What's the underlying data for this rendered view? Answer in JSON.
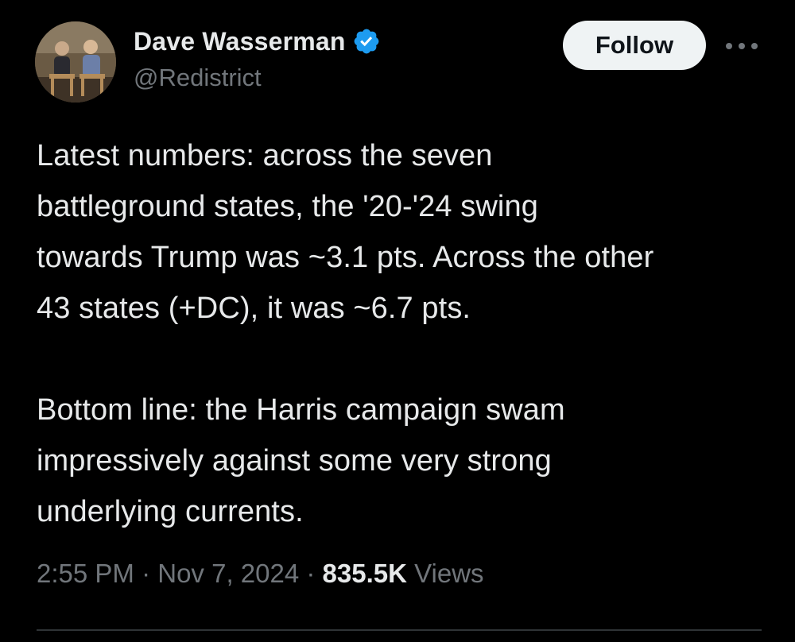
{
  "author": {
    "display_name": "Dave Wasserman",
    "handle": "@Redistrict",
    "verified": true,
    "avatar_icon": "avatar-photo-icon",
    "badge_icon": "verified-badge-icon"
  },
  "actions": {
    "follow_label": "Follow",
    "more_icon": "more-options-icon"
  },
  "tweet": {
    "text": "Latest numbers: across the seven\nbattleground states, the '20-'24 swing\ntowards Trump was ~3.1 pts. Across the other\n43 states (+DC), it was ~6.7 pts.\n\nBottom line: the Harris campaign swam\nimpressively against some very strong\nunderlying currents.",
    "time": "2:55 PM",
    "separator": " · ",
    "date": "Nov 7, 2024",
    "views_count": "835.5K",
    "views_label": "Views"
  },
  "colors": {
    "background": "#000000",
    "text_primary": "#e7e9ea",
    "text_secondary": "#71767b",
    "verified_blue": "#1d9bf0",
    "follow_bg": "#eff3f4",
    "divider": "#2f3336"
  }
}
